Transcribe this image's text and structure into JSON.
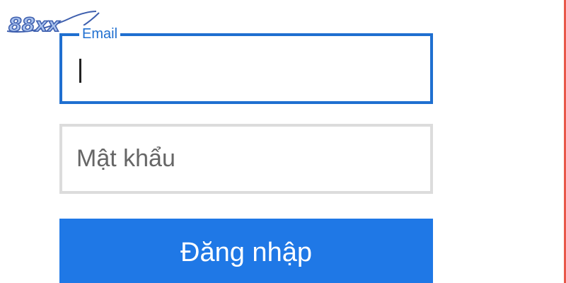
{
  "logo": {
    "text": "88xx",
    "colors": {
      "fill": "#a9c2ee",
      "stroke": "#3e5fae"
    }
  },
  "form": {
    "email": {
      "label": "Email",
      "value": "",
      "state": "focused",
      "border_color": "#1f6fd0"
    },
    "password": {
      "placeholder": "Mật khẩu",
      "value": "",
      "border_color": "#dcdcdc"
    },
    "submit": {
      "label": "Đăng nhập",
      "background": "#1f78e6"
    }
  },
  "accent": {
    "right_edge_color": "#e8584a"
  }
}
